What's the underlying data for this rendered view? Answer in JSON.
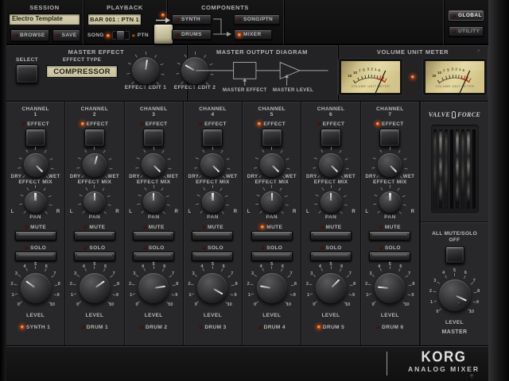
{
  "topbar": {
    "session": {
      "title": "SESSION",
      "name_value": "Electro Template",
      "browse_label": "BROWSE",
      "save_label": "SAVE"
    },
    "playback": {
      "title": "PLAYBACK",
      "position_display": "BAR 001 : PTN 1",
      "song_label": "SONG",
      "ptn_label": "PTN"
    },
    "components": {
      "title": "COMPONENTS",
      "synth_label": "SYNTH",
      "drums_label": "DRUMS",
      "songptn_label": "SONG/PTN",
      "mixer_label": "MIXER"
    },
    "global_label": "GLOBAL",
    "utility_label": "UTILITY"
  },
  "master_effect": {
    "title": "MASTER EFFECT",
    "select_label": "SELECT",
    "effect_type_label": "EFFECT TYPE",
    "effect_type_value": "COMPRESSOR",
    "edit1_label": "EFFECT EDIT 1",
    "edit2_label": "EFFECT EDIT 2",
    "edit1_angle": 8,
    "edit2_angle": -60
  },
  "output_diagram": {
    "title": "MASTER OUTPUT DIAGRAM",
    "effect_label": "MASTER EFFECT",
    "level_label": "MASTER LEVEL"
  },
  "vu_meter": {
    "title": "VOLUME UNIT METER",
    "face_text": "VOLUME UNIT METER",
    "scale_ticks": [
      "20",
      "10",
      "7",
      "5",
      "3",
      "2",
      "1",
      "0"
    ],
    "needle_angle": 24
  },
  "channel_shared": {
    "channel_word": "CHANNEL",
    "effect_label": "EFFECT",
    "dry_label": "DRY",
    "wet_label": "WET",
    "mix_label": "EFFECT MIX",
    "pan_label": "PAN",
    "left_label": "L",
    "right_label": "R",
    "mute_label": "MUTE",
    "solo_label": "SOLO",
    "level_label": "LEVEL",
    "level_ticks": [
      "0",
      "1",
      "2",
      "3",
      "4",
      "5",
      "6",
      "7",
      "8",
      "9",
      "10"
    ]
  },
  "channels": [
    {
      "number": "1",
      "name": "SYNTH 1",
      "effect_on": false,
      "mute_on": false,
      "solo_on": false,
      "name_on": true,
      "mix_angle": 135,
      "pan_angle": 0,
      "level_angle": -54
    },
    {
      "number": "2",
      "name": "DRUM 1",
      "effect_on": true,
      "mute_on": false,
      "solo_on": false,
      "name_on": false,
      "mix_angle": 15,
      "pan_angle": 0,
      "level_angle": 54
    },
    {
      "number": "3",
      "name": "DRUM 2",
      "effect_on": false,
      "mute_on": false,
      "solo_on": false,
      "name_on": false,
      "mix_angle": 135,
      "pan_angle": 0,
      "level_angle": 81
    },
    {
      "number": "4",
      "name": "DRUM 3",
      "effect_on": false,
      "mute_on": false,
      "solo_on": false,
      "name_on": false,
      "mix_angle": 135,
      "pan_angle": 0,
      "level_angle": 120
    },
    {
      "number": "5",
      "name": "DRUM 4",
      "effect_on": true,
      "mute_on": true,
      "solo_on": false,
      "name_on": false,
      "mix_angle": 135,
      "pan_angle": 0,
      "level_angle": -80
    },
    {
      "number": "6",
      "name": "DRUM 5",
      "effect_on": false,
      "mute_on": false,
      "solo_on": false,
      "name_on": true,
      "mix_angle": 135,
      "pan_angle": 0,
      "level_angle": 45
    },
    {
      "number": "7",
      "name": "DRUM 6",
      "effect_on": true,
      "mute_on": false,
      "solo_on": false,
      "name_on": false,
      "mix_angle": 135,
      "pan_angle": 0,
      "level_angle": -85
    }
  ],
  "sidebar": {
    "valve_label": "VALVE",
    "force_label": "FORCE",
    "all_mute_line1": "ALL MUTE/SOLO",
    "all_mute_line2": "OFF",
    "level_label": "LEVEL",
    "master_label": "MASTER",
    "master_level_angle": 115
  },
  "footer": {
    "brand": "KORG",
    "subtitle": "ANALOG MIXER"
  }
}
